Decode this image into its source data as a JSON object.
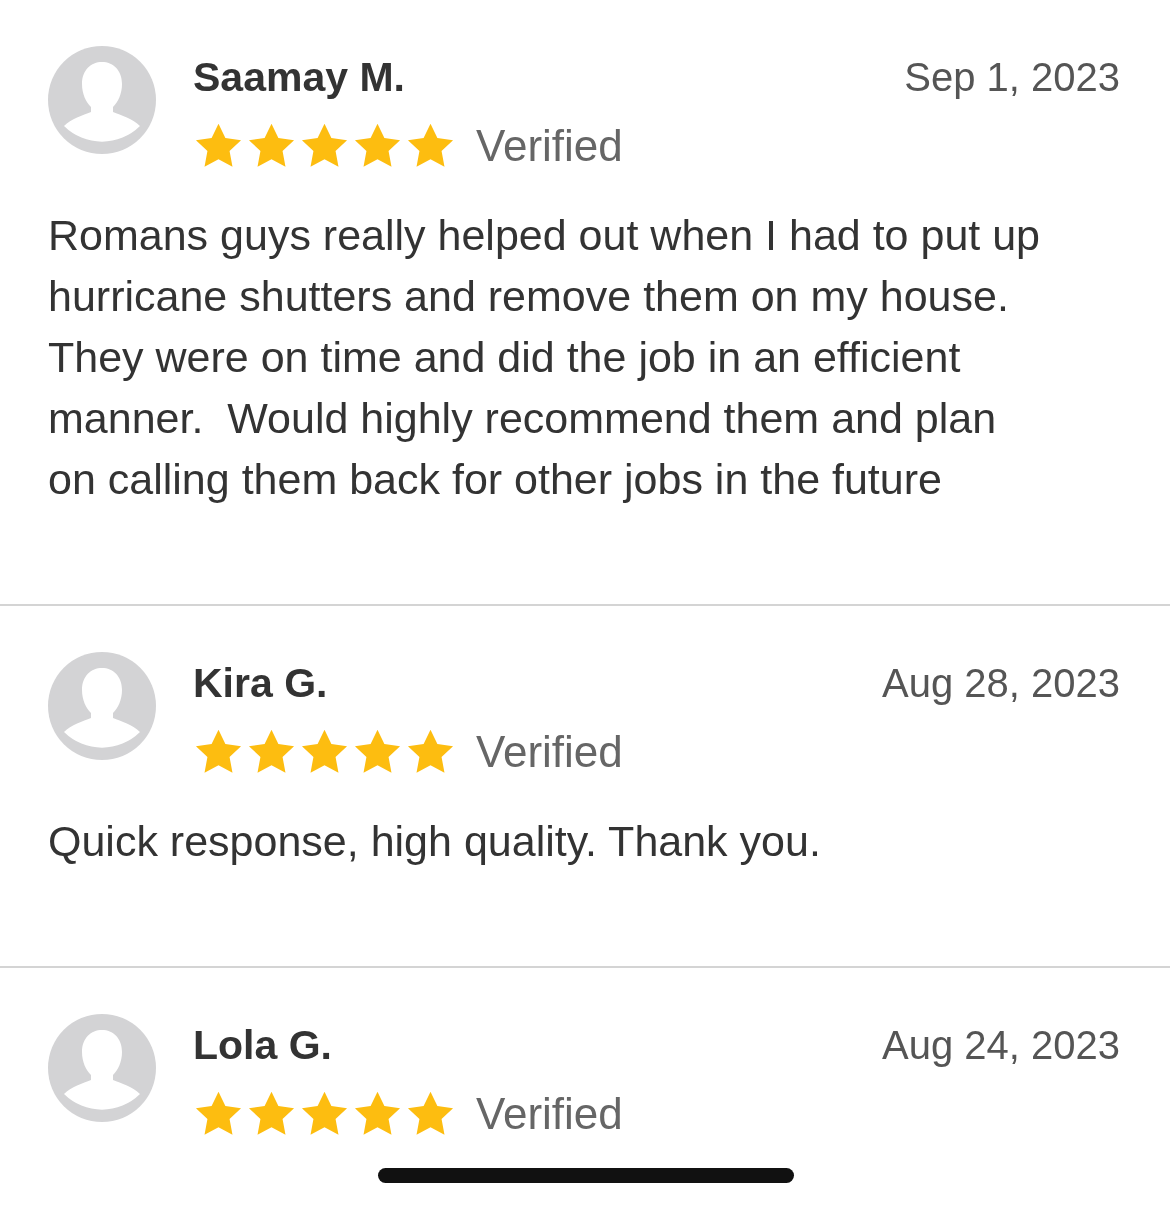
{
  "reviews": [
    {
      "name": "Saamay M.",
      "date": "Sep 1, 2023",
      "stars": 5,
      "badge": "Verified",
      "text": "Romans guys really helped out when I had to put up hurricane shutters and remove them on my house.  They were on time and did the job in an efficient manner.  Would highly recommend them and plan on calling them back for other jobs in the future"
    },
    {
      "name": "Kira G.",
      "date": "Aug 28, 2023",
      "stars": 5,
      "badge": "Verified",
      "text": "Quick response, high quality. Thank you."
    },
    {
      "name": "Lola G.",
      "date": "Aug 24, 2023",
      "stars": 5,
      "badge": "Verified"
    }
  ]
}
